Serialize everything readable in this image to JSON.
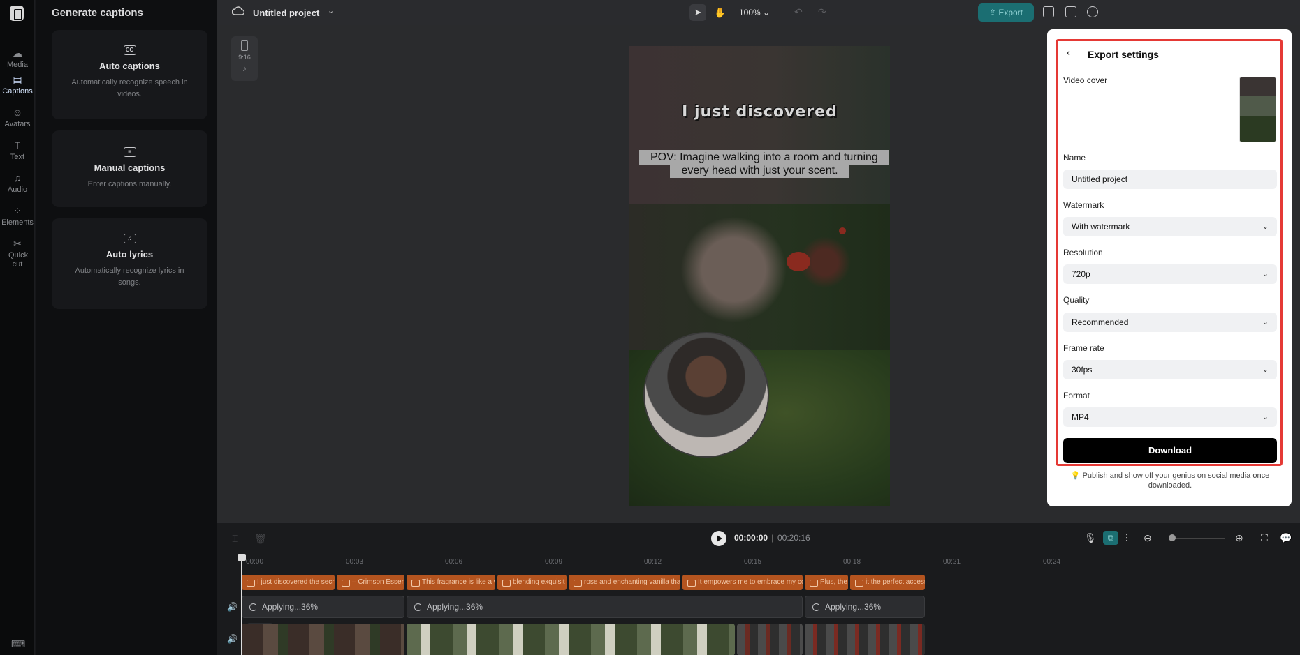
{
  "rail": {
    "items": [
      {
        "label": "Media",
        "icon": "media-icon"
      },
      {
        "label": "Captions",
        "icon": "captions-icon"
      },
      {
        "label": "Avatars",
        "icon": "avatars-icon"
      },
      {
        "label": "Text",
        "icon": "text-icon"
      },
      {
        "label": "Audio",
        "icon": "audio-icon"
      },
      {
        "label": "Elements",
        "icon": "elements-icon"
      },
      {
        "label": "Quick cut",
        "icon": "quick-cut-icon"
      }
    ]
  },
  "captions_panel": {
    "title": "Generate captions",
    "cards": [
      {
        "title": "Auto captions",
        "desc": "Automatically recognize speech in videos.",
        "icon_text": "CC"
      },
      {
        "title": "Manual captions",
        "desc": "Enter captions manually.",
        "icon_text": "≡"
      },
      {
        "title": "Auto lyrics",
        "desc": "Automatically recognize lyrics in songs.",
        "icon_text": "♫"
      }
    ]
  },
  "topbar": {
    "project_name": "Untitled project",
    "zoom": "100%",
    "export_label": "Export",
    "export_color": "#1b6e72"
  },
  "canvas": {
    "ratio": "9:16",
    "headline": "I just discovered",
    "subtitle": "POV: Imagine walking into a room and turning every head with just your scent."
  },
  "export_settings": {
    "title": "Export settings",
    "video_cover_label": "Video cover",
    "name_label": "Name",
    "name_value": "Untitled project",
    "watermark_label": "Watermark",
    "watermark_value": "With watermark",
    "resolution_label": "Resolution",
    "resolution_value": "720p",
    "quality_label": "Quality",
    "quality_value": "Recommended",
    "framerate_label": "Frame rate",
    "framerate_value": "30fps",
    "format_label": "Format",
    "format_value": "MP4",
    "download_label": "Download",
    "note": "Publish and show off your genius on social media once downloaded.",
    "highlight_color": "#e53935"
  },
  "timeline": {
    "current_time": "00:00:00",
    "separator": "|",
    "duration": "00:20:16",
    "ticks": [
      "00:00",
      "00:03",
      "00:06",
      "00:09",
      "00:12",
      "00:15",
      "00:18",
      "00:21",
      "00:24"
    ],
    "caption_clips": [
      "I just discovered the secret",
      "– Crimson Essence",
      "This fragrance is like a w",
      "blending exquisit",
      "rose and enchanting vanilla that",
      "It empowers me to embrace my co",
      "Plus, the",
      "it the perfect access"
    ],
    "apply_clips": [
      "Applying...36%",
      "Applying...36%",
      "Applying...36%"
    ]
  }
}
